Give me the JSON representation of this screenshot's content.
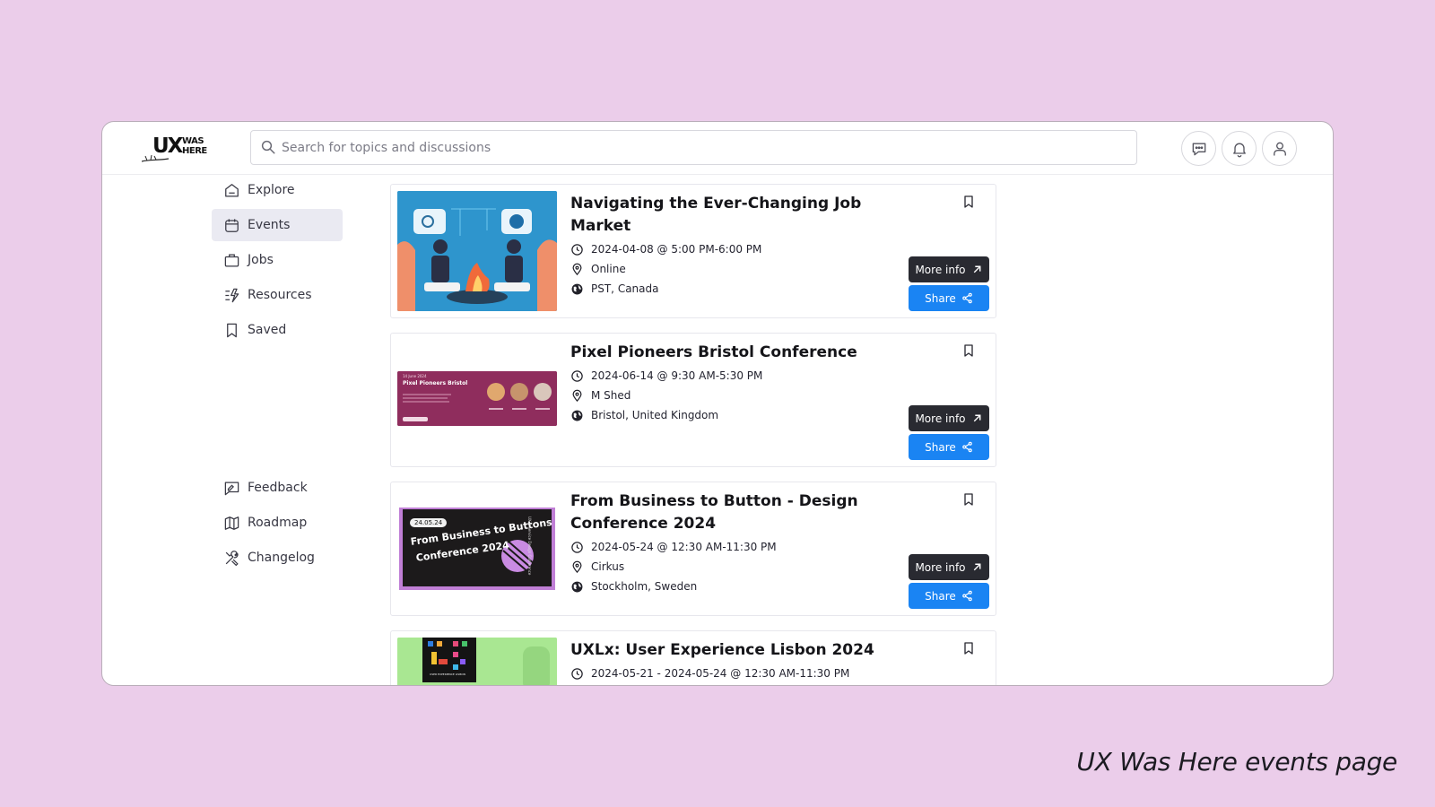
{
  "logo": {
    "line1": "UX",
    "line2": "WAS",
    "line3": "HERE"
  },
  "search": {
    "placeholder": "Search for topics and discussions"
  },
  "sidebar": {
    "items": [
      {
        "label": "Explore"
      },
      {
        "label": "Events"
      },
      {
        "label": "Jobs"
      },
      {
        "label": "Resources"
      },
      {
        "label": "Saved"
      },
      {
        "label": "Feedback"
      },
      {
        "label": "Roadmap"
      },
      {
        "label": "Changelog"
      }
    ]
  },
  "events": [
    {
      "title": "Navigating the Ever-Changing Job Market",
      "datetime": "2024-04-08 @ 5:00 PM-6:00 PM",
      "venue": "Online",
      "region": "PST, Canada",
      "more_label": "More info",
      "share_label": "Share"
    },
    {
      "title": "Pixel Pioneers Bristol Conference",
      "datetime": "2024-06-14 @ 9:30 AM-5:30 PM",
      "venue": "M Shed",
      "region": "Bristol, United Kingdom",
      "more_label": "More info",
      "share_label": "Share",
      "thumb_text": {
        "date": "14 June 2024",
        "name": "Pixel Pioneers Bristol"
      }
    },
    {
      "title": "From Business to Button - Design Conference 2024",
      "datetime": "2024-05-24 @ 12:30 AM-11:30 PM",
      "venue": "Cirkus",
      "region": "Stockholm, Sweden",
      "more_label": "More info",
      "share_label": "Share",
      "thumb_text": {
        "date": "24.05.24",
        "line1": "From Business to Buttons",
        "line2": "Conference 2024",
        "side": "UX & Service Design Conference"
      }
    },
    {
      "title": "UXLx: User Experience Lisbon 2024",
      "datetime": "2024-05-21 - 2024-05-24 @ 12:30 AM-11:30 PM",
      "thumb_text": {
        "name": "USER EXPERIENCE LISBON"
      }
    }
  ],
  "caption": "UX Was Here events page",
  "colors": {
    "page_bg": "#ebcdea",
    "active_nav": "#eaeaf2",
    "more_button": "#292a31",
    "share_button": "#1a84f3"
  },
  "icons": {
    "header": [
      "chat-icon",
      "bell-icon",
      "user-icon"
    ],
    "sidebar": [
      "home-icon",
      "calendar-icon",
      "briefcase-icon",
      "resources-icon",
      "bookmark-icon",
      "feedback-icon",
      "map-icon",
      "tools-icon"
    ]
  }
}
